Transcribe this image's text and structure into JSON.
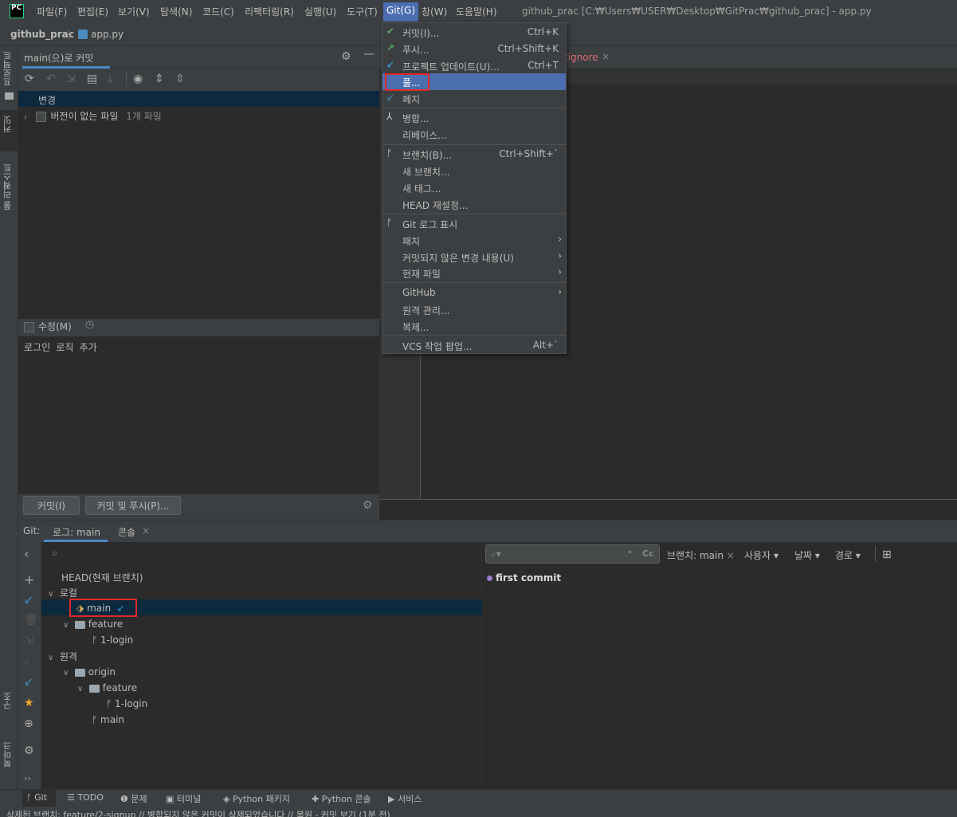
{
  "menubar": {
    "items": [
      "파일(F)",
      "편집(E)",
      "보기(V)",
      "탐색(N)",
      "코드(C)",
      "리팩터링(R)",
      "실행(U)",
      "도구(T)",
      "Git(G)",
      "창(W)",
      "도움말(H)"
    ],
    "window_title": "github_prac [C:₩Users₩USER₩Desktop₩GitPrac₩github_prac] - app.py",
    "logo": "PC"
  },
  "breadcrumb": {
    "project": "github_prac",
    "file": "app.py"
  },
  "left_strip": {
    "tabs": [
      "프로젝트",
      "커밋",
      "풀 리퀘스트",
      "구조",
      "북마크"
    ]
  },
  "commit_panel": {
    "tab": "main(으)로 커밋",
    "changes_label": "변경",
    "unversioned_label": "버전이 없는 파일",
    "unversioned_count": "1개 파일",
    "amend_label": "수정(M)",
    "message": "로그인 로직 추가",
    "commit_button": "커밋(I)",
    "commit_push_button": "커밋 및 푸시(P)..."
  },
  "editor": {
    "gitignore_tab": "tignore"
  },
  "git_menu": {
    "items": [
      {
        "label": "커밋(I)...",
        "shortcut": "Ctrl+K",
        "icon": "check-icon"
      },
      {
        "label": "푸시...",
        "shortcut": "Ctrl+Shift+K",
        "icon": "push-arrow-icon"
      },
      {
        "label": "프로젝트 업데이트(U)...",
        "shortcut": "Ctrl+T",
        "icon": "update-arrow-icon"
      },
      {
        "label": "풀...",
        "shortcut": "",
        "icon": ""
      },
      {
        "label": "페치",
        "shortcut": "",
        "icon": "fetch-arrow-icon"
      },
      {
        "label": "병합...",
        "shortcut": "",
        "icon": "merge-icon"
      },
      {
        "label": "리베이스...",
        "shortcut": "",
        "icon": ""
      },
      {
        "label": "브랜치(B)...",
        "shortcut": "Ctrl+Shift+`",
        "icon": "branch-icon"
      },
      {
        "label": "새 브랜치...",
        "shortcut": "",
        "icon": ""
      },
      {
        "label": "새 태그...",
        "shortcut": "",
        "icon": ""
      },
      {
        "label": "HEAD 재설정...",
        "shortcut": "",
        "icon": ""
      },
      {
        "label": "Git 로그 표시",
        "shortcut": "",
        "icon": "branch-icon"
      },
      {
        "label": "패치",
        "shortcut": "",
        "icon": ""
      },
      {
        "label": "커밋되지 않은 변경 내용(U)",
        "shortcut": "",
        "icon": ""
      },
      {
        "label": "현재 파일",
        "shortcut": "",
        "icon": ""
      },
      {
        "label": "GitHub",
        "shortcut": "",
        "icon": ""
      },
      {
        "label": "원격 관리...",
        "shortcut": "",
        "icon": ""
      },
      {
        "label": "복제...",
        "shortcut": "",
        "icon": ""
      },
      {
        "label": "VCS 작업 팝업...",
        "shortcut": "Alt+`",
        "icon": ""
      }
    ]
  },
  "bottom": {
    "git_label": "Git:",
    "log_tab": "로그: main",
    "console_tab": "콘솔",
    "branches": {
      "head": "HEAD(현재 브랜치)",
      "local": "로컬",
      "main": "main",
      "feature": "feature",
      "login": "1-login",
      "remote": "원격",
      "origin": "origin",
      "remote_feature": "feature",
      "remote_login": "1-login",
      "remote_main": "main"
    },
    "filters": {
      "branch": "브랜치: main",
      "user": "사용자",
      "date": "날짜",
      "path": "경로"
    },
    "regex": ".*",
    "case": "Cc",
    "commit": "first commit"
  },
  "toolbar": {
    "items": [
      "Git",
      "TODO",
      "문제",
      "터미널",
      "Python 패키지",
      "Python 콘솔",
      "서비스"
    ]
  },
  "status": {
    "text": "삭제된 브랜치: feature/2-signup // 병합되지 않은 커밋이 삭제되었습니다 // 복원 - 커밋 보기 (1분 전)"
  },
  "colors": {
    "menu_selected": "#4b6eaf",
    "highlight_box": "#e02828",
    "tab_underline": "#4a88c7",
    "selection_row": "#0d293e"
  }
}
